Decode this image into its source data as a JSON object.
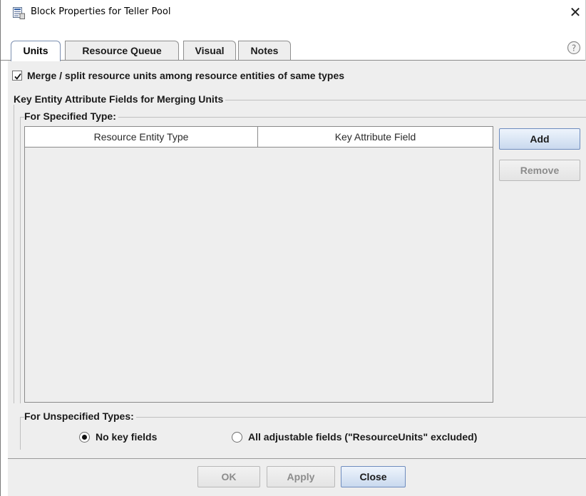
{
  "window": {
    "title": "Block Properties for Teller Pool",
    "close_glyph": "✕",
    "icon": "block-properties-icon"
  },
  "tabs": [
    {
      "label": "Units",
      "active": true
    },
    {
      "label": "Resource Queue",
      "active": false
    },
    {
      "label": "Visual",
      "active": false
    },
    {
      "label": "Notes",
      "active": false
    }
  ],
  "help": {
    "icon": "help-icon"
  },
  "merge": {
    "checked": true,
    "label": "Merge / split resource units among resource entities of same types"
  },
  "key_fields_group": {
    "title": "Key Entity Attribute Fields for Merging Units",
    "specified": {
      "title": "For Specified Type:",
      "columns": [
        "Resource Entity Type",
        "Key Attribute Field"
      ],
      "rows": [],
      "add_label": "Add",
      "remove_label": "Remove"
    },
    "unspecified": {
      "title": "For Unspecified Types:",
      "options": [
        {
          "label": "No key fields",
          "selected": true
        },
        {
          "label": "All adjustable fields (\"ResourceUnits\" excluded)",
          "selected": false
        }
      ]
    }
  },
  "footer": {
    "ok_label": "OK",
    "apply_label": "Apply",
    "close_label": "Close"
  },
  "colors": {
    "panel": "#eeeeee",
    "button_border": "#7f9db9",
    "disabled_text": "#8c8c8c"
  }
}
